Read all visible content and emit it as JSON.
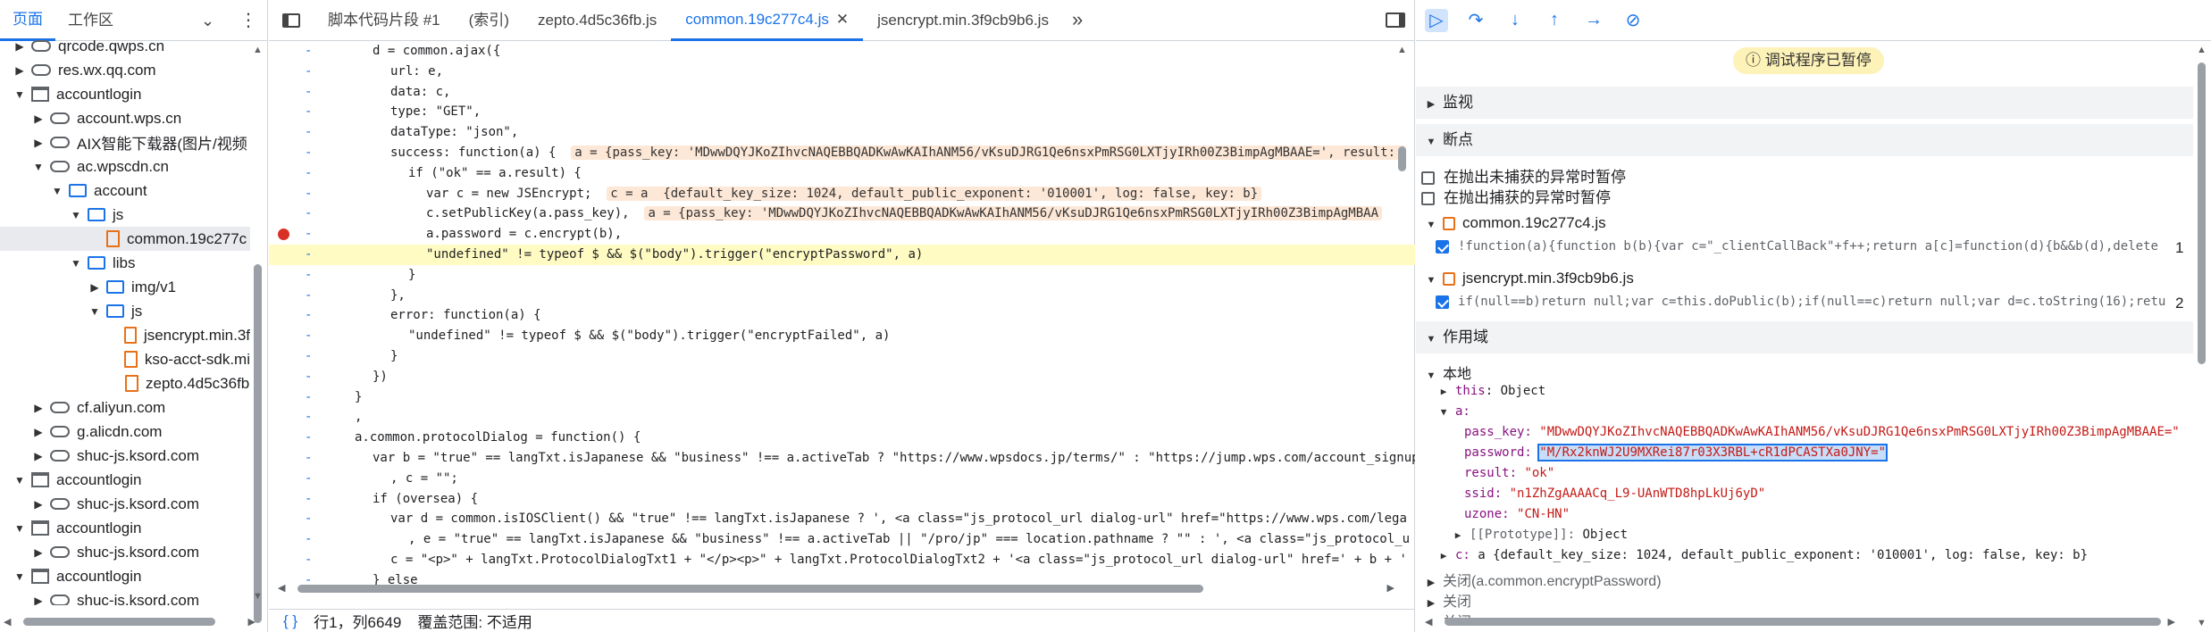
{
  "left_panel": {
    "tabs": [
      "页面",
      "工作区"
    ],
    "more_label": "»",
    "tree": [
      {
        "label": "qrcode.qwps.cn",
        "kind": "cloud",
        "depth": 1,
        "arrow": "▶"
      },
      {
        "label": "res.wx.qq.com",
        "kind": "cloud",
        "depth": 1,
        "arrow": "▶"
      },
      {
        "label": "accountlogin",
        "kind": "frame",
        "depth": 1,
        "arrow": "▼"
      },
      {
        "label": "account.wps.cn",
        "kind": "cloud",
        "depth": 2,
        "arrow": "▶"
      },
      {
        "label": "AIX智能下载器(图片/视频",
        "kind": "cloud",
        "depth": 2,
        "arrow": "▶"
      },
      {
        "label": "ac.wpscdn.cn",
        "kind": "cloud",
        "depth": 2,
        "arrow": "▼"
      },
      {
        "label": "account",
        "kind": "folder",
        "depth": 3,
        "arrow": "▼"
      },
      {
        "label": "js",
        "kind": "folder",
        "depth": 4,
        "arrow": "▼"
      },
      {
        "label": "common.19c277c",
        "kind": "file",
        "depth": 5,
        "arrow": "",
        "selected": true
      },
      {
        "label": "libs",
        "kind": "folder",
        "depth": 4,
        "arrow": "▼"
      },
      {
        "label": "img/v1",
        "kind": "folder",
        "depth": 5,
        "arrow": "▶"
      },
      {
        "label": "js",
        "kind": "folder",
        "depth": 5,
        "arrow": "▼"
      },
      {
        "label": "jsencrypt.min.3f",
        "kind": "file",
        "depth": 6,
        "arrow": ""
      },
      {
        "label": "kso-acct-sdk.mi",
        "kind": "file",
        "depth": 6,
        "arrow": ""
      },
      {
        "label": "zepto.4d5c36fb",
        "kind": "file",
        "depth": 6,
        "arrow": ""
      },
      {
        "label": "cf.aliyun.com",
        "kind": "cloud",
        "depth": 2,
        "arrow": "▶"
      },
      {
        "label": "g.alicdn.com",
        "kind": "cloud",
        "depth": 2,
        "arrow": "▶"
      },
      {
        "label": "shuc-js.ksord.com",
        "kind": "cloud",
        "depth": 2,
        "arrow": "▶"
      },
      {
        "label": "accountlogin",
        "kind": "frame",
        "depth": 1,
        "arrow": "▼"
      },
      {
        "label": "shuc-js.ksord.com",
        "kind": "cloud",
        "depth": 2,
        "arrow": "▶"
      },
      {
        "label": "accountlogin",
        "kind": "frame",
        "depth": 1,
        "arrow": "▼"
      },
      {
        "label": "shuc-js.ksord.com",
        "kind": "cloud",
        "depth": 2,
        "arrow": "▶"
      },
      {
        "label": "accountlogin",
        "kind": "frame",
        "depth": 1,
        "arrow": "▼"
      },
      {
        "label": "shuc-js.ksord.com",
        "kind": "cloud",
        "depth": 2,
        "arrow": "▶"
      }
    ]
  },
  "editor": {
    "tabs": [
      {
        "label": "脚本代码片段 #1",
        "active": false
      },
      {
        "label": "(索引)",
        "active": false
      },
      {
        "label": "zepto.4d5c36fb.js",
        "active": false
      },
      {
        "label": "common.19c277c4.js",
        "active": true
      },
      {
        "label": "jsencrypt.min.3f9cb9b6.js",
        "active": false
      }
    ],
    "close_glyph": "✕",
    "overflow_glyph": "»",
    "lines": [
      {
        "indent": 4,
        "text": "d = common.ajax({"
      },
      {
        "indent": 6,
        "text": "url: e,"
      },
      {
        "indent": 6,
        "text": "data: c,"
      },
      {
        "indent": 6,
        "text": "type: \"GET\","
      },
      {
        "indent": 6,
        "text": "dataType: \"json\","
      },
      {
        "indent": 6,
        "text": "success: function(a) {",
        "inline": "a = {pass_key: 'MDwwDQYJKoZIhvcNAQEBBQADKwAwKAIhANM56/vKsuDJRG1Qe6nsxPmRSG0LXTjyIRh00Z3BimpAgMBAAE=', result: "
      },
      {
        "indent": 8,
        "text": "if (\"ok\" == a.result) {"
      },
      {
        "indent": 10,
        "text": "var c = new JSEncrypt;",
        "inline": "c = a  {default_key_size: 1024, default_public_exponent: '010001', log: false, key: b}"
      },
      {
        "indent": 10,
        "text": "c.setPublicKey(a.pass_key),",
        "inline": "a = {pass_key: 'MDwwDQYJKoZIhvcNAQEBBQADKwAwKAIhANM56/vKsuDJRG1Qe6nsxPmRSG0LXTjyIRh00Z3BimpAgMBAA"
      },
      {
        "indent": 10,
        "text": "a.password = c.encrypt(b),",
        "breakpoint": true
      },
      {
        "indent": 10,
        "text": "\"undefined\" != typeof $ && $(\"body\").trigger(\"encryptPassword\", a)",
        "highlight": true
      },
      {
        "indent": 8,
        "text": "}"
      },
      {
        "indent": 6,
        "text": "},"
      },
      {
        "indent": 6,
        "text": "error: function(a) {"
      },
      {
        "indent": 8,
        "text": "\"undefined\" != typeof $ && $(\"body\").trigger(\"encryptFailed\", a)"
      },
      {
        "indent": 6,
        "text": "}"
      },
      {
        "indent": 4,
        "text": "})"
      },
      {
        "indent": 2,
        "text": "}"
      },
      {
        "indent": 2,
        "text": ","
      },
      {
        "indent": 2,
        "text": "a.common.protocolDialog = function() {"
      },
      {
        "indent": 4,
        "text": "var b = \"true\" == langTxt.isJapanese && \"business\" !== a.activeTab ? \"https://www.wpsdocs.jp/terms/\" : \"https://jump.wps.com/account_signup"
      },
      {
        "indent": 6,
        "text": ", c = \"\";"
      },
      {
        "indent": 4,
        "text": "if (oversea) {"
      },
      {
        "indent": 6,
        "text": "var d = common.isIOSClient() && \"true\" !== langTxt.isJapanese ? ', <a class=\"js_protocol_url dialog-url\" href=\"https://www.wps.com/lega"
      },
      {
        "indent": 8,
        "text": ", e = \"true\" == langTxt.isJapanese && \"business\" !== a.activeTab || \"/pro/jp\" === location.pathname ? \"\" : ', <a class=\"js_protocol_u"
      },
      {
        "indent": 6,
        "text": "c = \"<p>\" + langTxt.ProtocolDialogTxt1 + \"</p><p>\" + langTxt.ProtocolDialogTxt2 + '<a class=\"js_protocol_url dialog-url\" href=' + b + '"
      },
      {
        "indent": 4,
        "text": "} else"
      }
    ],
    "status": {
      "braces": "{ }",
      "position": "行1，列6649",
      "coverage": "覆盖范围: 不适用"
    }
  },
  "debugger": {
    "paused_label": "调试程序已暂停",
    "sections": {
      "watch": "监视",
      "breakpoints": "断点",
      "scope": "作用域",
      "local": "本地"
    },
    "pause_uncaught": "在抛出未捕获的异常时暂停",
    "pause_caught": "在抛出捕获的异常时暂停",
    "bp_files": [
      {
        "file": "common.19c277c4.js",
        "code": "!function(a){function b(b){var c=\"_clientCallBack\"+f++;return a[c]=function(d){b&&b(d),delete ",
        "line": "1"
      },
      {
        "file": "jsencrypt.min.3f9cb9b6.js",
        "code": "if(null==b)return null;var c=this.doPublic(b);if(null==c)return null;var d=c.toString(16);retu",
        "line": "2"
      }
    ],
    "scope": {
      "this_label": "this",
      "this_value": "Object",
      "a_label": "a:",
      "pass_key_name": "pass_key:",
      "pass_key_value": "\"MDwwDQYJKoZIhvcNAQEBBQADKwAwKAIhANM56/vKsuDJRG1Qe6nsxPmRSG0LXTjyIRh00Z3BimpAgMBAAE=\"",
      "password_name": "password:",
      "password_value": "\"M/Rx2knWJ2U9MXRei87r03X3RBL+cR1dPCASTXa0JNY=\"",
      "result_name": "result:",
      "result_value": "\"ok\"",
      "ssid_name": "ssid:",
      "ssid_value": "\"n1ZhZgAAAACq_L9-UAnWTD8hpLkUj6yD\"",
      "uzone_name": "uzone:",
      "uzone_value": "\"CN-HN\"",
      "prototype_name": "[[Prototype]]:",
      "prototype_value": "Object",
      "c_name": "c:",
      "c_value": "a  {default_key_size: 1024, default_public_exponent: '010001', log: false, key: b}",
      "closure1": "关闭(a.common.encryptPassword)",
      "closure2": "关闭",
      "closure3": "关闭"
    }
  },
  "colors": {
    "accent": "#1a73e8",
    "highlight": "#fffbc2",
    "paused": "#fdf2b7",
    "breakpoint": "#d93025"
  }
}
